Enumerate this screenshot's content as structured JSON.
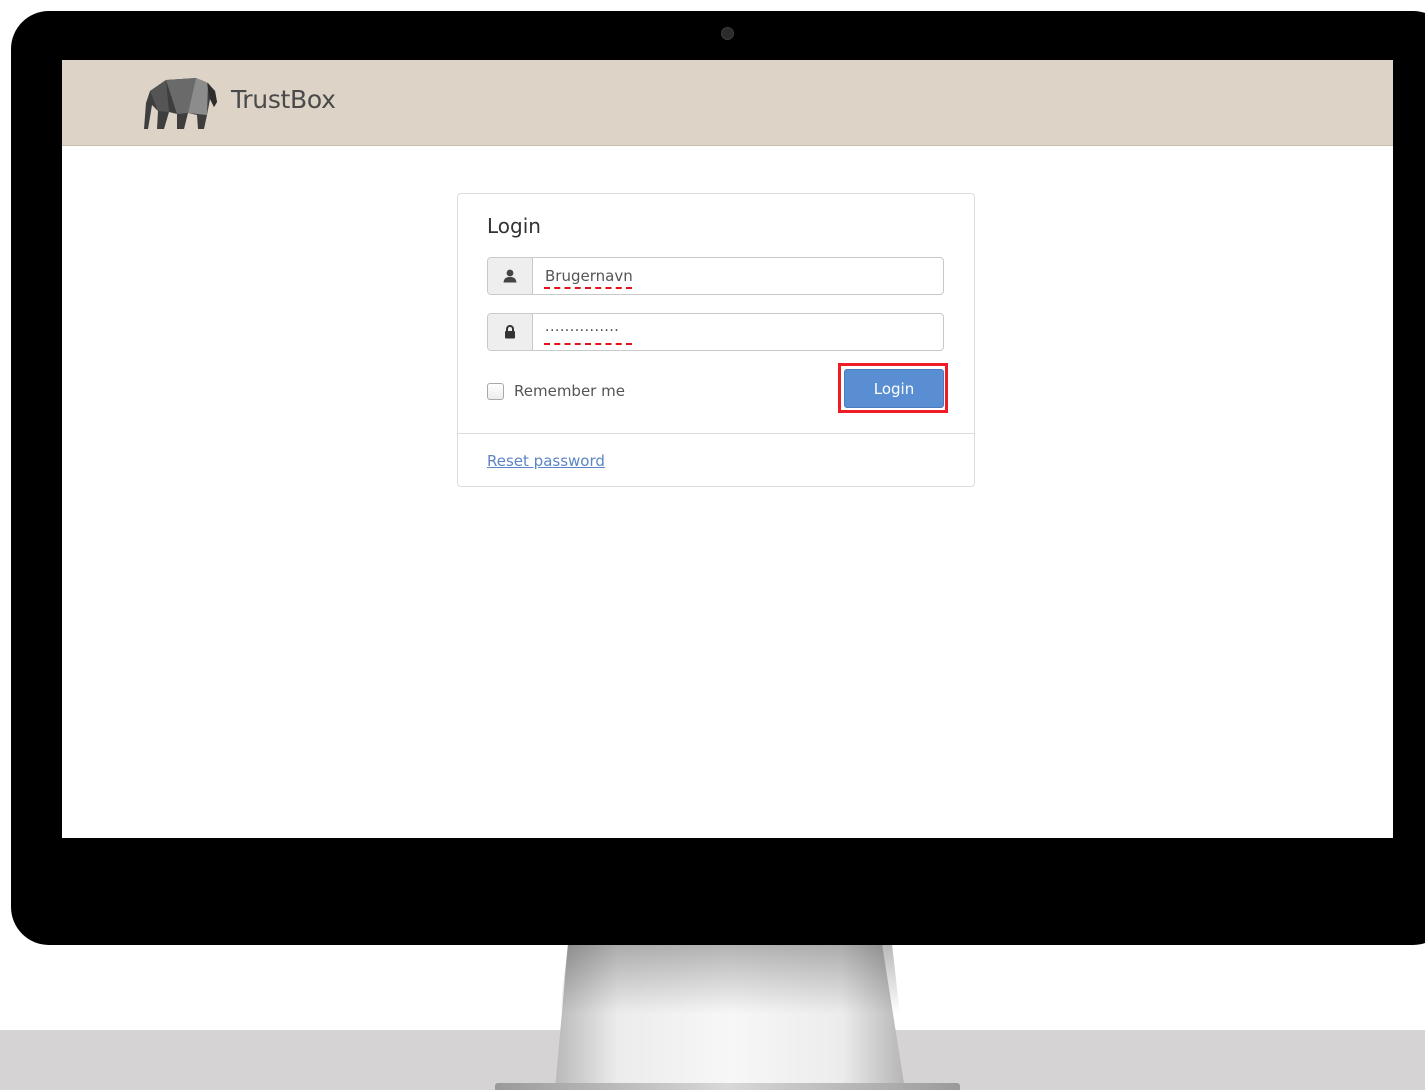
{
  "app": {
    "brand": "TrustBox",
    "logo_icon": "elephant-logo-icon"
  },
  "login": {
    "title": "Login",
    "username": {
      "value": "Brugernavn",
      "icon": "user-icon"
    },
    "password": {
      "masked_value": "...............",
      "icon": "lock-icon"
    },
    "remember_label": "Remember me",
    "remember_checked": false,
    "submit_label": "Login",
    "reset_label": "Reset password"
  },
  "colors": {
    "header_bg": "#ddd4c7",
    "button_bg": "#5a8ed2",
    "highlight": "#ee1c24",
    "link": "#5b84c4",
    "spellcheck": "#e0131b"
  }
}
